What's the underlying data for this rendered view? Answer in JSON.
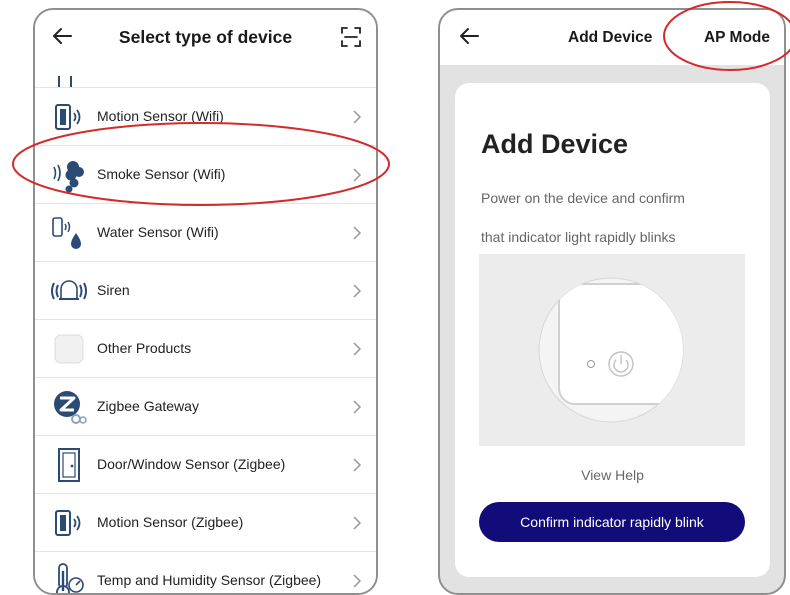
{
  "left_screen": {
    "title": "Select type of device",
    "items": [
      {
        "label": "Motion Sensor (Wifi)",
        "icon": "motion-sensor-icon"
      },
      {
        "label": "Smoke Sensor (Wifi)",
        "icon": "smoke-sensor-icon"
      },
      {
        "label": "Water Sensor (Wifi)",
        "icon": "water-sensor-icon"
      },
      {
        "label": "Siren",
        "icon": "siren-icon"
      },
      {
        "label": "Other Products",
        "icon": "other-products-icon"
      },
      {
        "label": "Zigbee Gateway",
        "icon": "zigbee-gateway-icon"
      },
      {
        "label": "Door/Window Sensor (Zigbee)",
        "icon": "door-window-sensor-icon"
      },
      {
        "label": "Motion Sensor (Zigbee)",
        "icon": "motion-sensor-icon"
      },
      {
        "label": "Temp and Humidity Sensor (Zigbee)",
        "icon": "thermometer-icon"
      }
    ]
  },
  "right_screen": {
    "title": "Add Device",
    "mode_button": "AP Mode",
    "card_title": "Add Device",
    "desc_line1": "Power on the device and confirm",
    "desc_line2": "that indicator light rapidly blinks",
    "view_help": "View Help",
    "confirm_button": "Confirm indicator rapidly blink"
  },
  "colors": {
    "annotation": "#d42a2a",
    "primary_button": "#120c7a",
    "icon_blue": "#2b4a74"
  }
}
